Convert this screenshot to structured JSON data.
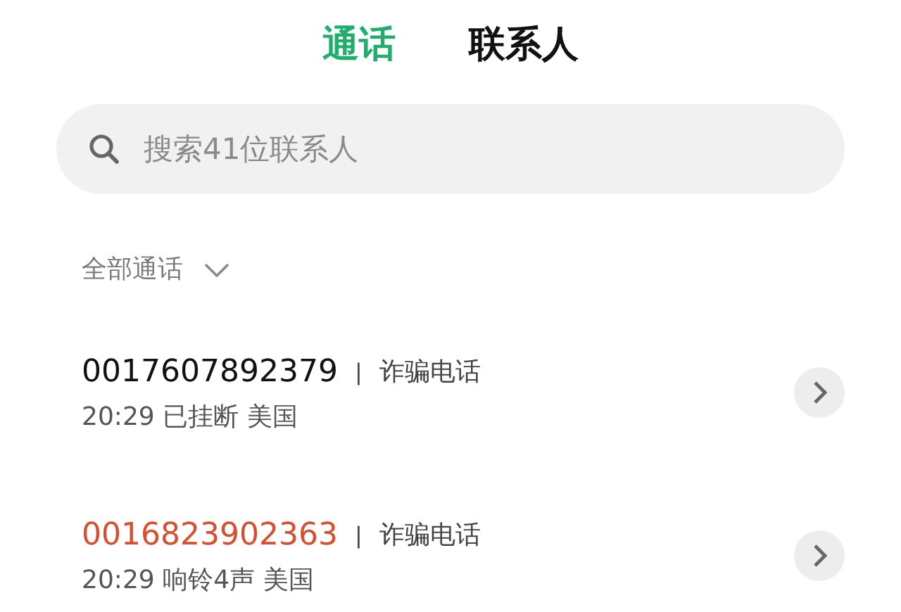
{
  "tabs": [
    {
      "label": "通话",
      "selected": true
    },
    {
      "label": "联系人",
      "selected": false
    }
  ],
  "search": {
    "placeholder": "搜索41位联系人"
  },
  "filter": {
    "label": "全部通话"
  },
  "calls": [
    {
      "number": "0017607892379",
      "separator": "|",
      "tag": "诈骗电话",
      "detail": "20:29 已挂断 美国",
      "missed": false
    },
    {
      "number": "0016823902363",
      "separator": "|",
      "tag": "诈骗电话",
      "detail": "20:29 响铃4声 美国",
      "missed": true
    }
  ]
}
